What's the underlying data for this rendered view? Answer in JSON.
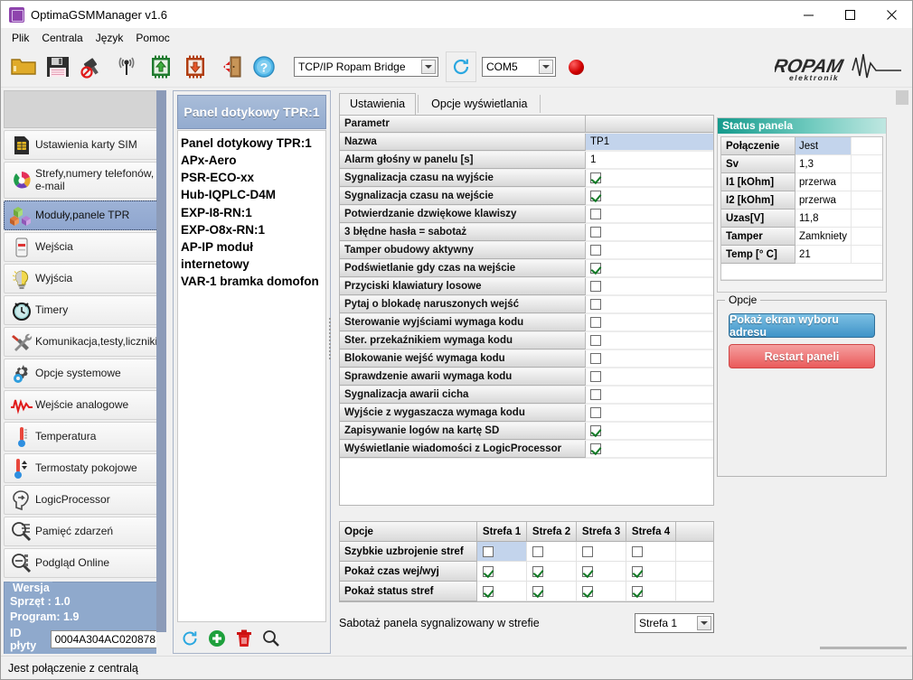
{
  "window": {
    "title": "OptimaGSMManager v1.6",
    "icon": "app-icon",
    "minimize": "–",
    "maximize": "□",
    "close": "✕"
  },
  "menu": {
    "items": [
      {
        "label": "Plik",
        "accel": "P"
      },
      {
        "label": "Centrala",
        "accel": "C"
      },
      {
        "label": "Język",
        "accel": "J"
      },
      {
        "label": "Pomoc",
        "accel": "P"
      }
    ]
  },
  "toolbar": {
    "icons": [
      {
        "name": "open-folder-icon",
        "title": "Otwórz"
      },
      {
        "name": "save-floppy-icon",
        "title": "Zapisz"
      },
      {
        "name": "no-connect-icon",
        "title": "Rozłącz"
      },
      {
        "name": "antenna-signal-icon",
        "title": "Połączenie zdalne"
      },
      {
        "name": "chip-upload-icon",
        "title": "Odczyt z centrali"
      },
      {
        "name": "chip-download-icon",
        "title": "Zapis do centrali"
      },
      {
        "name": "exit-door-icon",
        "title": "Wyjście"
      },
      {
        "name": "help-question-icon",
        "title": "Pomoc"
      }
    ],
    "protocol_combo": {
      "value": "TCP/IP Ropam Bridge"
    },
    "refresh_icon": "refresh-circle-icon",
    "port_combo": {
      "value": "COM5"
    },
    "led": {
      "name": "status-led",
      "color": "#d00000"
    },
    "logo": {
      "brand": "ROPAM",
      "sub": "elektronik"
    }
  },
  "sidebar": {
    "items": [
      {
        "label": "Ustawienia karty SIM",
        "icon": "sim-card-icon",
        "selected": false
      },
      {
        "label": "Strefy,numery telefonów,\ne-mail",
        "icon": "pie-chart-icon",
        "selected": false
      },
      {
        "label": "Moduły,panele TPR",
        "icon": "cubes-icon",
        "selected": true
      },
      {
        "label": "Wejścia",
        "icon": "motion-sensor-icon",
        "selected": false
      },
      {
        "label": "Wyjścia",
        "icon": "lightbulb-icon",
        "selected": false
      },
      {
        "label": "Timery",
        "icon": "alarm-clock-icon",
        "selected": false
      },
      {
        "label": "Komunikacja,testy,liczniki",
        "icon": "hammer-wrench-icon",
        "selected": false
      },
      {
        "label": "Opcje systemowe",
        "icon": "gear-icon",
        "selected": false
      },
      {
        "label": "Wejście analogowe",
        "icon": "waveform-icon",
        "selected": false
      },
      {
        "label": "Temperatura",
        "icon": "thermometer-icon",
        "selected": false
      },
      {
        "label": "Termostaty pokojowe",
        "icon": "thermostat-icon",
        "selected": false
      },
      {
        "label": "LogicProcessor",
        "icon": "brain-icon",
        "selected": false
      },
      {
        "label": "Pamięć zdarzeń",
        "icon": "event-log-icon",
        "selected": false
      },
      {
        "label": "Podgląd Online",
        "icon": "online-preview-icon",
        "selected": false
      }
    ],
    "version": {
      "legend": "Wersja",
      "hardware": "Sprzęt : 1.0",
      "program": "Program: 1.9",
      "id_label": "ID płyty",
      "id_value": "0004A304AC020878"
    }
  },
  "modules": {
    "header": "Panel dotykowy TPR:1",
    "list": [
      "Panel dotykowy TPR:1",
      "APx-Aero",
      "PSR-ECO-xx",
      "Hub-IQPLC-D4M",
      "EXP-I8-RN:1",
      "EXP-O8x-RN:1",
      "AP-IP moduł internetowy",
      "VAR-1 bramka domofon"
    ],
    "tools": [
      {
        "name": "refresh-icon",
        "title": "Odśwież"
      },
      {
        "name": "add-icon",
        "title": "Dodaj"
      },
      {
        "name": "delete-icon",
        "title": "Usuń"
      },
      {
        "name": "search-icon",
        "title": "Szukaj"
      }
    ]
  },
  "main": {
    "tabs": [
      {
        "label": "Ustawienia",
        "active": true
      },
      {
        "label": "Opcje wyświetlania",
        "active": false
      }
    ],
    "grid": {
      "header": {
        "label": "Parametr",
        "value": ""
      },
      "rows": [
        {
          "label": "Nazwa",
          "type": "text",
          "value": "TP1",
          "selected": true
        },
        {
          "label": "Alarm głośny w panelu [s]",
          "type": "text",
          "value": "1",
          "selected": false
        },
        {
          "label": "Sygnalizacja czasu na wyjście",
          "type": "check",
          "checked": true
        },
        {
          "label": "Sygnalizacja czasu na wejście",
          "type": "check",
          "checked": true
        },
        {
          "label": "Potwierdzanie dzwiękowe klawiszy",
          "type": "check",
          "checked": false
        },
        {
          "label": "3 błędne hasła = sabotaż",
          "type": "check",
          "checked": false
        },
        {
          "label": "Tamper obudowy aktywny",
          "type": "check",
          "checked": false
        },
        {
          "label": "Podświetlanie gdy czas na wejście",
          "type": "check",
          "checked": true
        },
        {
          "label": "Przyciski klawiatury losowe",
          "type": "check",
          "checked": false
        },
        {
          "label": "Pytaj o blokadę naruszonych wejść",
          "type": "check",
          "checked": false
        },
        {
          "label": "Sterowanie wyjściami wymaga kodu",
          "type": "check",
          "checked": false
        },
        {
          "label": "Ster. przekaźnikiem wymaga kodu",
          "type": "check",
          "checked": false
        },
        {
          "label": "Blokowanie wejść wymaga kodu",
          "type": "check",
          "checked": false
        },
        {
          "label": "Sprawdzenie awarii wymaga kodu",
          "type": "check",
          "checked": false
        },
        {
          "label": "Sygnalizacja awarii cicha",
          "type": "check",
          "checked": false
        },
        {
          "label": "Wyjście z wygaszacza wymaga kodu",
          "type": "check",
          "checked": false
        },
        {
          "label": "Zapisywanie  logów na  kartę SD",
          "type": "check",
          "checked": true
        },
        {
          "label": "Wyświetlanie wiadomości z LogicProcessor",
          "type": "check",
          "checked": true
        }
      ]
    },
    "zones": {
      "columns": [
        "Opcje",
        "Strefa 1",
        "Strefa 2",
        "Strefa 3",
        "Strefa 4"
      ],
      "rows": [
        {
          "label": "Szybkie uzbrojenie stref",
          "values": [
            false,
            false,
            false,
            false
          ],
          "selected": true
        },
        {
          "label": "Pokaż czas wej/wyj",
          "values": [
            true,
            true,
            true,
            true
          ],
          "selected": false
        },
        {
          "label": "Pokaż status stref",
          "values": [
            true,
            true,
            true,
            true
          ],
          "selected": false
        }
      ]
    },
    "sabotage": {
      "label": "Sabotaż panela sygnalizowany w strefie",
      "combo_value": "Strefa 1"
    }
  },
  "status_panel": {
    "title": "Status panela",
    "rows": [
      {
        "label": "Połączenie",
        "value": "Jest"
      },
      {
        "label": "Sv",
        "value": "1,3"
      },
      {
        "label": "I1 [kOhm]",
        "value": "przerwa"
      },
      {
        "label": "I2 [kOhm]",
        "value": "przerwa"
      },
      {
        "label": "Uzas[V]",
        "value": "11,8"
      },
      {
        "label": "Tamper",
        "value": "Zamkniety"
      },
      {
        "label": "Temp [° C]",
        "value": "21"
      }
    ]
  },
  "options_group": {
    "legend": "Opcje",
    "buttons": [
      {
        "label": "Pokaż ekran wyboru adresu",
        "style": "blue"
      },
      {
        "label": "Restart  paneli",
        "style": "red"
      }
    ]
  },
  "statusbar": {
    "text": "Jest połączenie z centralą"
  }
}
